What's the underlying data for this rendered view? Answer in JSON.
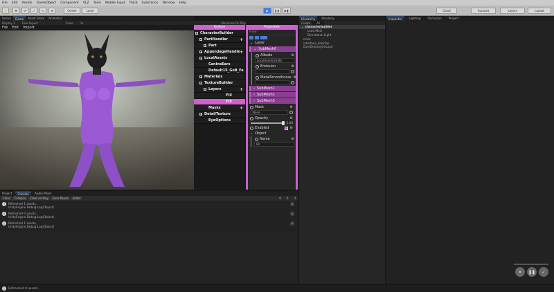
{
  "menubar": [
    "File",
    "Edit",
    "Assets",
    "GameObject",
    "Component",
    "VLZ",
    "Tools",
    "Mobile Input",
    "TriLib",
    "Substance",
    "Window",
    "Help"
  ],
  "toolbar": {
    "center_label": "Center",
    "local_label": "Local",
    "cloud_label": "Cloud",
    "account_label": "Account",
    "layers_label": "Layers",
    "layout_label": "Layout"
  },
  "left_tabs": [
    "Scene",
    "Game",
    "Asset Store",
    "Animator"
  ],
  "game_bar": {
    "display": "Display 1",
    "aspect": "Free Aspect",
    "scale_label": "Scale",
    "scale_value": "1x",
    "right_buttons": [
      "Maximize On Play",
      "Mute Audio",
      "Stats",
      "Gizmos"
    ]
  },
  "builder_menu": [
    "File",
    "Edit",
    "Import"
  ],
  "outline": {
    "tab_outline": "Outline",
    "tab_properties": "Properties",
    "items": [
      {
        "label": "CharacterBuilder",
        "indent": 0,
        "pm": "−",
        "sel": false,
        "plus": false
      },
      {
        "label": "PartHandler",
        "indent": 1,
        "pm": "−",
        "sel": false,
        "plus": true
      },
      {
        "label": "Part",
        "indent": 2,
        "pm": "+",
        "sel": false,
        "plus": false
      },
      {
        "label": "AppendageHandler",
        "indent": 1,
        "pm": "+",
        "sel": false,
        "plus": true
      },
      {
        "label": "LocalAssets",
        "indent": 1,
        "pm": "−",
        "sel": false,
        "plus": false
      },
      {
        "label": "CanineEars",
        "indent": 2,
        "pm": "",
        "sel": false,
        "plus": false
      },
      {
        "label": "Default15_GoB_Fe",
        "indent": 2,
        "pm": "",
        "sel": false,
        "plus": false
      },
      {
        "label": "Materials",
        "indent": 1,
        "pm": "+",
        "sel": false,
        "plus": false
      },
      {
        "label": "TextureBuilder",
        "indent": 1,
        "pm": "−",
        "sel": false,
        "plus": false
      },
      {
        "label": "Layers",
        "indent": 2,
        "pm": "−",
        "sel": false,
        "plus": true
      },
      {
        "label": "Fill",
        "indent": 3,
        "pm": "",
        "sel": false,
        "plus": false
      },
      {
        "label": "Fill",
        "indent": 3,
        "pm": "",
        "sel": true,
        "plus": false
      },
      {
        "label": "Masks",
        "indent": 2,
        "pm": "",
        "sel": false,
        "plus": true
      },
      {
        "label": "DetailTexture",
        "indent": 1,
        "pm": "+",
        "sel": false,
        "plus": false
      },
      {
        "label": "EyeOptions",
        "indent": 2,
        "pm": "",
        "sel": false,
        "plus": false
      }
    ]
  },
  "properties": {
    "filter_placeholder": "Filter",
    "layer_label": "Layer",
    "submesh0": "SubMesh0",
    "albedo_label": "Albedo",
    "albedo_value": "LocalAssets/cd56c",
    "emission_label": "Emission",
    "metal_label": "MetalSmoothness",
    "submesh1": "SubMesh1",
    "submesh2": "SubMesh2",
    "submesh3": "SubMesh3",
    "mask_label": "Mask",
    "mask_value": "None",
    "opacity_label": "Opacity",
    "opacity_value": "1.00",
    "opacity_fraction": 1.0,
    "enabled_label": "Enabled",
    "object_label": "Object",
    "name_label": "Name",
    "name_value": "Fill"
  },
  "hierarchy": {
    "tab": "Hierarchy",
    "tab2": "Shaderly",
    "create_label": "Create",
    "search_placeholder": "All",
    "scene": "characterbuilder",
    "rows": [
      "Lead Main",
      "Directional Light",
      "main",
      "interface_desktop",
      "DontDestroyOnLoad"
    ]
  },
  "right_tabs": [
    "Inspector",
    "Lighting",
    "Occlusion",
    "Project"
  ],
  "console": {
    "tabs": [
      "Project",
      "Console",
      "Audio Mixer"
    ],
    "buttons": [
      "Clear",
      "Collapse",
      "Clear on Play",
      "Error Pause",
      "Editor"
    ],
    "counts": [
      "0",
      "0",
      "3"
    ],
    "messages": [
      {
        "line1": "Refreshed 1 assets.",
        "line2": "UnityEngine.Debug:Log(Object)",
        "count": "1"
      },
      {
        "line1": "Refreshed 0 assets.",
        "line2": "UnityEngine.Debug:Log(Object)",
        "count": "1"
      },
      {
        "line1": "Refreshed 1 assets.",
        "line2": "UnityEngine.Debug:Log(Object)",
        "count": "1"
      }
    ]
  },
  "status_text": "Refreshed 0 assets.",
  "colors": {
    "accent": "#c464cc",
    "selection": "#d05fd0",
    "play_blue": "#3b7ee8"
  }
}
